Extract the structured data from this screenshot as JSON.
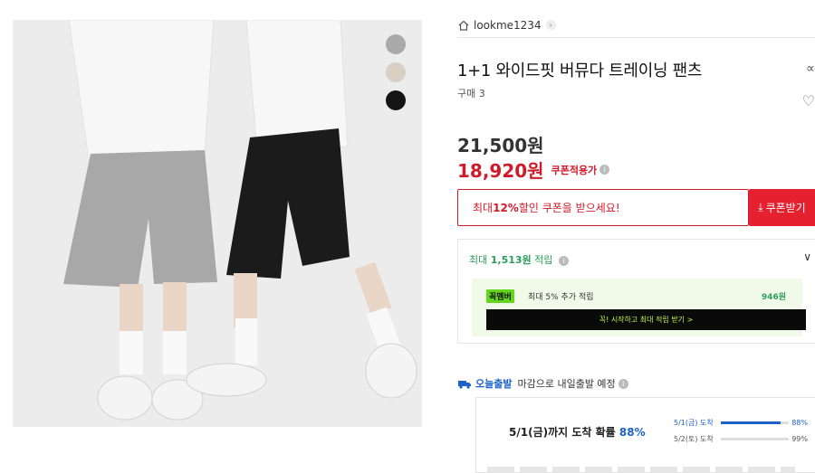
{
  "product": {
    "brand": "lookme1234",
    "title": "1+1 와이드핏 버뮤다 트레이닝 팬츠",
    "purchase_count": "구매 3",
    "price_original": "21,500원",
    "price_sale": "18,920원",
    "coupon_applied_label": "쿠폰적용가"
  },
  "color_options": [
    {
      "name": "gray",
      "hex": "#a9a9a9"
    },
    {
      "name": "beige",
      "hex": "#d8d0c3"
    },
    {
      "name": "black",
      "hex": "#141414"
    }
  ],
  "coupon": {
    "banner_prefix": "최대 ",
    "banner_pct": "12%",
    "banner_suffix": " 할인 쿠폰을 받으세요!",
    "button_label": "쿠폰받기"
  },
  "points": {
    "prefix": "최대 ",
    "amount": "1,513원",
    "suffix": " 적립",
    "member_badge": "꼭멤버",
    "member_text": "최대 5% 추가 적립",
    "member_amount": "946원",
    "member_cta": "꼭! 시작하고 최대 적립 받기 >"
  },
  "delivery": {
    "tag": "오늘출발",
    "text": "마감으로 내일출발 예정",
    "arrival_prefix": "5/1(금)까지 도착 확률 ",
    "arrival_pct": "88%",
    "bars": [
      {
        "label": "5/1(금) 도착",
        "percent": "88%",
        "value": 0.88,
        "color": "#1c62c9",
        "text_color": "#1c62c9"
      },
      {
        "label": "5/2(토) 도착",
        "percent": "99%",
        "value": 0.99,
        "color": "#dddddd",
        "text_color": "#555555"
      }
    ]
  },
  "colors": {
    "sale_red": "#d11a2a",
    "coupon_button": "#e5202f",
    "points_green": "#2e9d5c",
    "delivery_blue": "#1c62c9"
  }
}
